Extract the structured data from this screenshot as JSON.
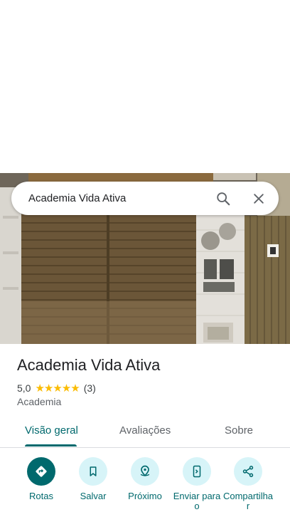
{
  "search": {
    "query": "Academia Vida Ativa"
  },
  "place": {
    "name": "Academia Vida Ativa",
    "rating": "5,0",
    "stars": "★★★★★",
    "review_count": "(3)",
    "category": "Academia"
  },
  "tabs": [
    {
      "label": "Visão geral"
    },
    {
      "label": "Avaliações"
    },
    {
      "label": "Sobre"
    }
  ],
  "actions": [
    {
      "label": "Rotas",
      "icon": "directions-icon"
    },
    {
      "label": "Salvar",
      "icon": "bookmark-icon"
    },
    {
      "label": "Próximo",
      "icon": "nearby-icon"
    },
    {
      "label": "Enviar para o",
      "icon": "send-to-phone-icon"
    },
    {
      "label": "Compartilhar",
      "icon": "share-icon"
    }
  ],
  "colors": {
    "accent": "#00696d",
    "action_bg": "#d7f4f8",
    "star": "#fbbc04"
  }
}
